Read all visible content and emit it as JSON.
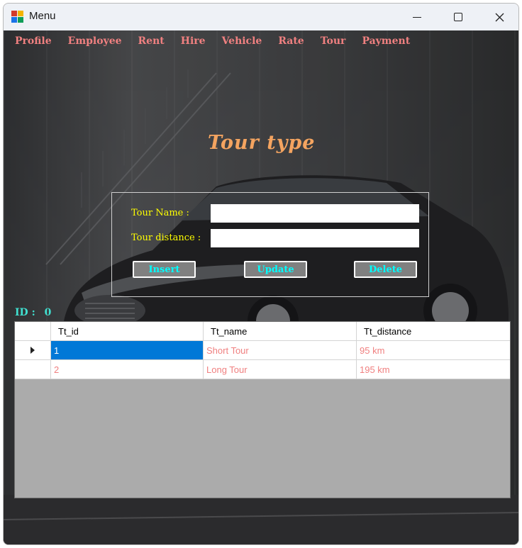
{
  "window": {
    "title": "Menu"
  },
  "menu": {
    "items": [
      "Profile",
      "Employee",
      "Rent",
      "Hire",
      "Vehicle",
      "Rate",
      "Tour",
      "Payment"
    ]
  },
  "form": {
    "heading": "Tour type",
    "tour_name_label": "Tour Name :",
    "tour_name_value": "",
    "tour_distance_label": "Tour distance :",
    "tour_distance_value": "",
    "insert_label": "Insert",
    "update_label": "Update",
    "delete_label": "Delete",
    "id_label": "ID :",
    "id_value": "0"
  },
  "grid": {
    "columns": [
      "Tt_id",
      "Tt_name",
      "Tt_distance"
    ],
    "rows": [
      {
        "Tt_id": "1",
        "Tt_name": "Short Tour",
        "Tt_distance": "95 km",
        "selected": true
      },
      {
        "Tt_id": "2",
        "Tt_name": "Long Tour",
        "Tt_distance": "195 km",
        "selected": false
      }
    ]
  },
  "colors": {
    "menu_text": "#f08080",
    "heading": "#f4a460",
    "form_label": "#ffff00",
    "button_text": "#00ffff",
    "button_bg": "#808080",
    "id_label": "#40e0d0",
    "grid_cell_text": "#f08080",
    "grid_selection": "#0078d7",
    "grid_empty_area": "#ababab"
  },
  "icons": {
    "app": "app-icon",
    "minimize": "minimize-icon",
    "maximize": "maximize-icon",
    "close": "close-icon",
    "row_indicator": "row-indicator-icon"
  }
}
